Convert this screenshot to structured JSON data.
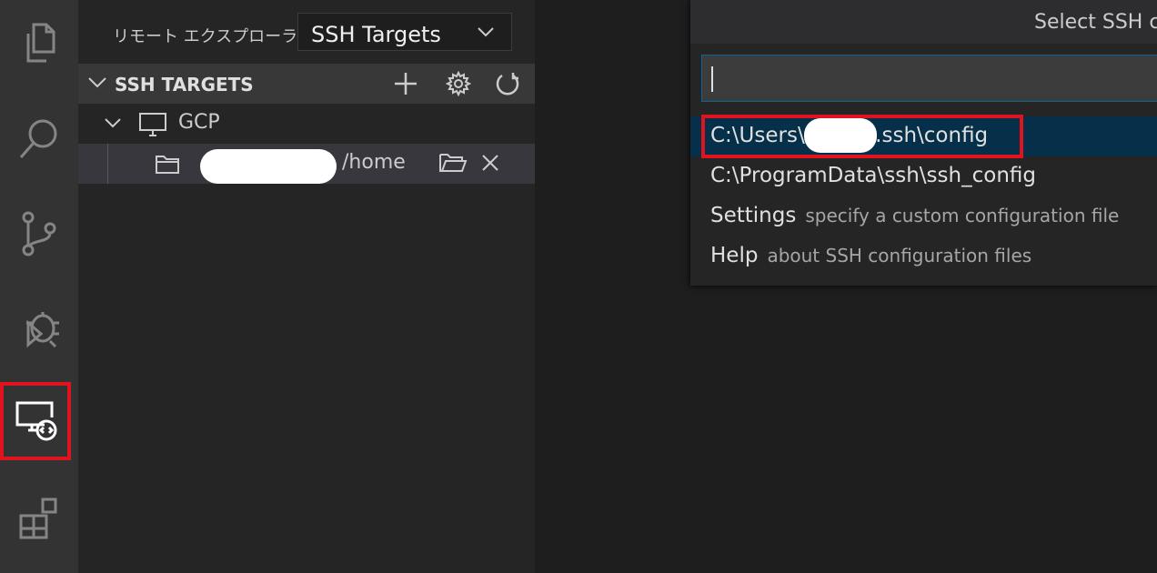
{
  "activity_bar": {
    "items": [
      {
        "name": "explorer",
        "icon": "files-icon"
      },
      {
        "name": "search",
        "icon": "search-icon"
      },
      {
        "name": "source-control",
        "icon": "source-control-icon"
      },
      {
        "name": "debug",
        "icon": "debug-icon"
      },
      {
        "name": "remote-explorer",
        "icon": "remote-explorer-icon",
        "highlighted": true
      },
      {
        "name": "extensions",
        "icon": "extensions-icon"
      }
    ]
  },
  "sidebar": {
    "title": "リモート エクスプローラー",
    "target_select": "SSH Targets",
    "section": {
      "label": "SSH TARGETS",
      "actions": [
        "add-icon",
        "gear-icon",
        "refresh-icon"
      ]
    },
    "tree": {
      "host": "GCP",
      "folder_path": "/home"
    }
  },
  "quickpick": {
    "title": "Select SSH c",
    "input_value": "",
    "items": [
      {
        "label": "C:\\Users\\r",
        "label_suffix": ".ssh\\config",
        "description": "",
        "active": true
      },
      {
        "label": "C:\\ProgramData\\ssh\\ssh_config",
        "label_suffix": "",
        "description": "",
        "active": false
      },
      {
        "label": "Settings",
        "label_suffix": "",
        "description": "specify a custom configuration file",
        "active": false
      },
      {
        "label": "Help",
        "label_suffix": "",
        "description": "about SSH configuration files",
        "active": false
      }
    ]
  },
  "colors": {
    "highlight_box": "#e0141e",
    "active_item_bg": "#062f4a",
    "focus_border": "#0e639c"
  }
}
